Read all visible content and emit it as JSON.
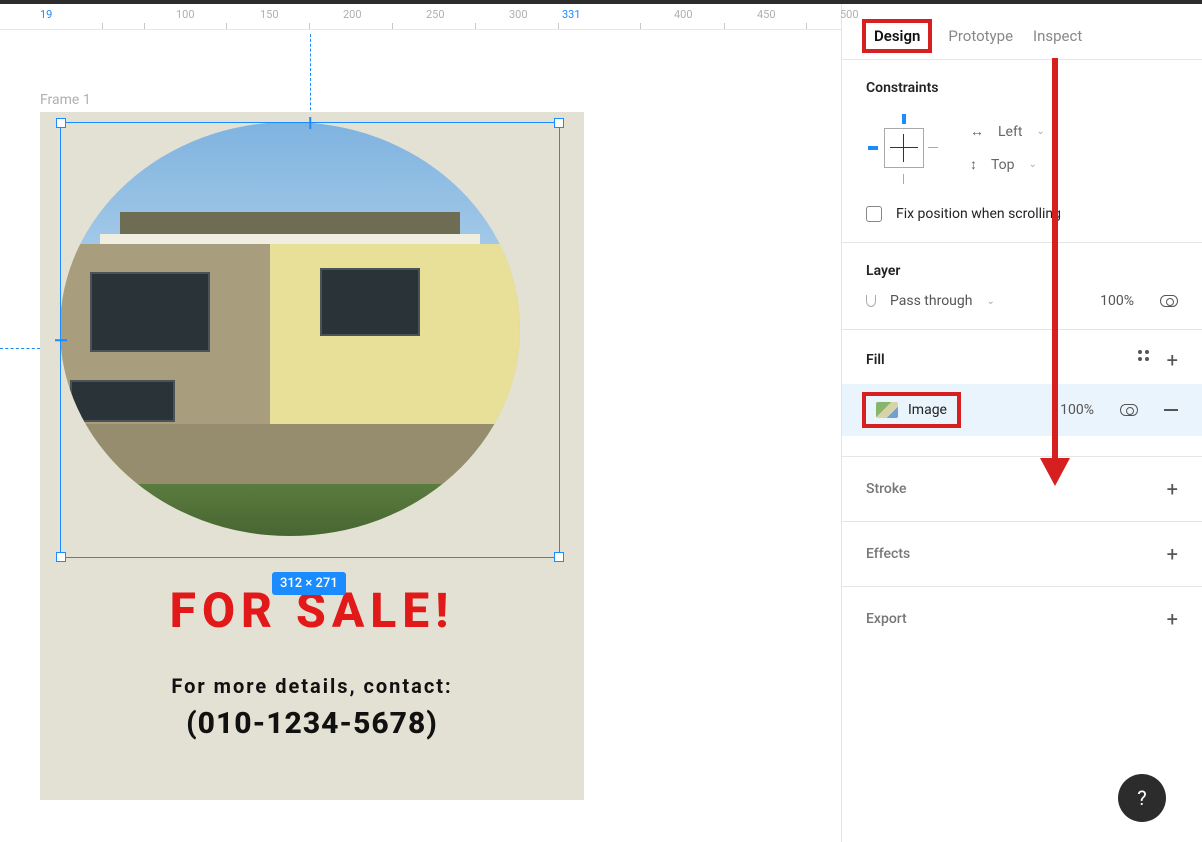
{
  "ruler": {
    "ticks": [
      {
        "value": "19",
        "pos": 48,
        "active": true
      },
      {
        "value": "100",
        "pos": 184,
        "active": false
      },
      {
        "value": "150",
        "pos": 268,
        "active": false
      },
      {
        "value": "200",
        "pos": 351,
        "active": false
      },
      {
        "value": "250",
        "pos": 434,
        "active": false
      },
      {
        "value": "300",
        "pos": 517,
        "active": false
      },
      {
        "value": "331",
        "pos": 570,
        "active": true
      },
      {
        "value": "400",
        "pos": 682,
        "active": false
      },
      {
        "value": "450",
        "pos": 765,
        "active": false
      },
      {
        "value": "500",
        "pos": 848,
        "active": false
      }
    ],
    "small_ticks": [
      102,
      144,
      226,
      309,
      392,
      475,
      558,
      640,
      724,
      806
    ]
  },
  "canvas": {
    "frame_name": "Frame 1",
    "selection_dimensions": "312 × 271",
    "flyer": {
      "headline": "FOR SALE!",
      "contact_label": "For more details, contact:",
      "phone": "(010-1234-5678)"
    }
  },
  "sidebar": {
    "tabs": {
      "design": "Design",
      "prototype": "Prototype",
      "inspect": "Inspect"
    },
    "constraints": {
      "title": "Constraints",
      "horizontal": "Left",
      "vertical": "Top",
      "fix_label": "Fix position when scrolling"
    },
    "layer": {
      "title": "Layer",
      "blend_mode": "Pass through",
      "opacity": "100%"
    },
    "fill": {
      "title": "Fill",
      "type_label": "Image",
      "opacity": "100%"
    },
    "stroke": {
      "title": "Stroke"
    },
    "effects": {
      "title": "Effects"
    },
    "export": {
      "title": "Export"
    }
  },
  "help_label": "?"
}
